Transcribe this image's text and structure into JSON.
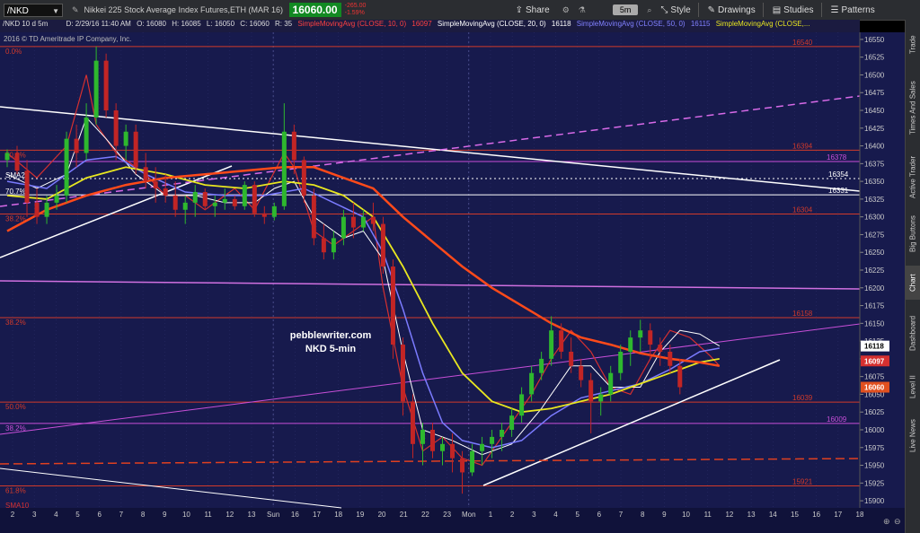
{
  "toolbar": {
    "symbol": "/NKD",
    "description": "Nikkei 225 Stock Average Index Futures,ETH (MAR 16)",
    "last": "16060.00",
    "change": "-265.00",
    "change_pct": "-1.59%",
    "share_label": "Share",
    "timeframe": "5m",
    "style_label": "Style",
    "drawings_label": "Drawings",
    "studies_label": "Studies",
    "patterns_label": "Patterns"
  },
  "infobar": {
    "chart_label": "/NKD 10 d 5m",
    "date": "D: 2/29/16 11:40 AM",
    "open": "O: 16080",
    "high": "H: 16085",
    "low": "L: 16050",
    "close": "C: 16060",
    "range": "R: 35",
    "sma10": "SimpleMovingAvg (CLOSE, 10, 0)",
    "sma10_val": "16097",
    "sma20": "SimpleMovingAvg (CLOSE, 20, 0)",
    "sma20_val": "16118",
    "sma50": "SimpleMovingAvg (CLOSE, 50, 0)",
    "sma50_val": "16115",
    "sma100": "SimpleMovingAvg (CLOSE,..."
  },
  "colors": {
    "background": "#171a4d",
    "candle_up": "#2eb82e",
    "candle_down": "#c22525",
    "sma10": "#d63030",
    "sma20": "#ffffff",
    "sma50": "#7b7bff",
    "sma100": "#e8e620",
    "sma200": "#ff4a1a",
    "fib_red": "#d13a2a",
    "fib_purple": "#c84fd8"
  },
  "sidebar_tabs": [
    "Trade",
    "Times And Sales",
    "Active Trader",
    "Big Buttons",
    "Chart",
    "Dashboard",
    "Level II",
    "Live News"
  ],
  "sidebar_active": "Chart",
  "chart_data": {
    "type": "candlestick",
    "copyright": "2016 © TD Ameritrade IP Company, Inc.",
    "annotation": [
      "pebblewriter.com",
      "NKD 5-min"
    ],
    "ylim": [
      15890,
      16560
    ],
    "y_ticks": [
      15900,
      15925,
      15950,
      15975,
      16000,
      16025,
      16050,
      16075,
      16100,
      16125,
      16150,
      16175,
      16200,
      16225,
      16250,
      16275,
      16300,
      16325,
      16350,
      16375,
      16400,
      16425,
      16450,
      16475,
      16500,
      16525,
      16550
    ],
    "x_ticks": [
      "2",
      "3",
      "4",
      "5",
      "6",
      "7",
      "8",
      "9",
      "10",
      "11",
      "12",
      "13",
      "Sun",
      "16",
      "17",
      "18",
      "19",
      "20",
      "21",
      "22",
      "23",
      "Mon",
      "1",
      "2",
      "3",
      "4",
      "5",
      "6",
      "7",
      "8",
      "9",
      "10",
      "11",
      "12",
      "13",
      "14",
      "15",
      "16",
      "17",
      "18"
    ],
    "x_grid_labels": [
      "Sun",
      "Mon"
    ],
    "fib_levels": [
      {
        "label": "0.0%",
        "value": 16540,
        "price_label": "16540",
        "color": "red"
      },
      {
        "label": "50.0%",
        "value": 16394,
        "price_label": "16394",
        "color": "red"
      },
      {
        "label": "",
        "value": 16378,
        "price_label": "16378",
        "color": "purple"
      },
      {
        "label": "38.2%",
        "value": 16304,
        "price_label": "16304",
        "color": "red"
      },
      {
        "label": "38.2%",
        "value": 16158,
        "price_label": "16158",
        "color": "red"
      },
      {
        "label": "50.0%",
        "value": 16039,
        "price_label": "16039",
        "color": "red"
      },
      {
        "label": "38.2%",
        "value": 16009,
        "price_label": "16009",
        "color": "purple"
      },
      {
        "label": "61.8%",
        "value": 15921,
        "price_label": "15921",
        "color": "red"
      }
    ],
    "white_levels": [
      {
        "label": "SMA20",
        "value": 16354,
        "price_label": "16354"
      },
      {
        "label": "70.7%",
        "value": 16331,
        "price_label": "16331"
      }
    ],
    "sma_text_labels": [
      "SMA10"
    ],
    "last_price_tags": [
      {
        "value": 16118,
        "label": "16118",
        "bg": "#ffffff",
        "fg": "#000000"
      },
      {
        "value": 16097,
        "label": "16097",
        "bg": "#d63030",
        "fg": "#ffffff"
      },
      {
        "value": 16060,
        "label": "16060",
        "bg": "#e05020",
        "fg": "#ffffff"
      }
    ],
    "series": [
      {
        "name": "SMA10",
        "values": [
          [
            0,
            16390
          ],
          [
            3,
            16355
          ],
          [
            6,
            16400
          ],
          [
            8,
            16500
          ],
          [
            9,
            16430
          ],
          [
            11,
            16390
          ],
          [
            14,
            16360
          ],
          [
            16,
            16330
          ],
          [
            18,
            16330
          ],
          [
            20,
            16310
          ],
          [
            23,
            16340
          ],
          [
            25,
            16310
          ],
          [
            28,
            16390
          ],
          [
            29,
            16370
          ],
          [
            31,
            16280
          ],
          [
            33,
            16260
          ],
          [
            35,
            16280
          ],
          [
            37,
            16300
          ],
          [
            38,
            16200
          ],
          [
            40,
            16060
          ],
          [
            42,
            15970
          ],
          [
            44,
            15990
          ],
          [
            46,
            15960
          ],
          [
            48,
            15950
          ],
          [
            50,
            15990
          ],
          [
            53,
            16050
          ],
          [
            55,
            16100
          ],
          [
            57,
            16140
          ],
          [
            59,
            16110
          ],
          [
            61,
            16060
          ],
          [
            63,
            16050
          ],
          [
            65,
            16100
          ],
          [
            67,
            16140
          ],
          [
            69,
            16130
          ],
          [
            71,
            16105
          ],
          [
            72,
            16090
          ]
        ]
      },
      {
        "name": "SMA20",
        "values": [
          [
            0,
            16360
          ],
          [
            3,
            16340
          ],
          [
            6,
            16360
          ],
          [
            8,
            16440
          ],
          [
            10,
            16410
          ],
          [
            13,
            16360
          ],
          [
            16,
            16330
          ],
          [
            19,
            16330
          ],
          [
            22,
            16320
          ],
          [
            25,
            16320
          ],
          [
            27,
            16340
          ],
          [
            29,
            16350
          ],
          [
            31,
            16300
          ],
          [
            34,
            16270
          ],
          [
            36,
            16280
          ],
          [
            38,
            16240
          ],
          [
            40,
            16110
          ],
          [
            42,
            16000
          ],
          [
            45,
            15985
          ],
          [
            48,
            15965
          ],
          [
            51,
            15980
          ],
          [
            54,
            16030
          ],
          [
            57,
            16090
          ],
          [
            59,
            16090
          ],
          [
            61,
            16060
          ],
          [
            64,
            16060
          ],
          [
            66,
            16110
          ],
          [
            68,
            16140
          ],
          [
            70,
            16135
          ],
          [
            72,
            16118
          ]
        ]
      },
      {
        "name": "SMA50",
        "values": [
          [
            0,
            16350
          ],
          [
            4,
            16340
          ],
          [
            8,
            16380
          ],
          [
            11,
            16385
          ],
          [
            14,
            16360
          ],
          [
            18,
            16335
          ],
          [
            22,
            16330
          ],
          [
            26,
            16330
          ],
          [
            30,
            16340
          ],
          [
            33,
            16320
          ],
          [
            36,
            16300
          ],
          [
            38,
            16250
          ],
          [
            40,
            16170
          ],
          [
            42,
            16080
          ],
          [
            44,
            16010
          ],
          [
            46,
            15985
          ],
          [
            49,
            15975
          ],
          [
            52,
            15985
          ],
          [
            55,
            16020
          ],
          [
            58,
            16045
          ],
          [
            61,
            16055
          ],
          [
            64,
            16065
          ],
          [
            67,
            16085
          ],
          [
            70,
            16110
          ],
          [
            72,
            16115
          ]
        ]
      },
      {
        "name": "SMA100",
        "values": [
          [
            0,
            16330
          ],
          [
            4,
            16325
          ],
          [
            8,
            16355
          ],
          [
            12,
            16370
          ],
          [
            16,
            16360
          ],
          [
            20,
            16345
          ],
          [
            24,
            16340
          ],
          [
            28,
            16350
          ],
          [
            31,
            16345
          ],
          [
            34,
            16330
          ],
          [
            37,
            16300
          ],
          [
            40,
            16230
          ],
          [
            43,
            16150
          ],
          [
            46,
            16080
          ],
          [
            49,
            16040
          ],
          [
            52,
            16025
          ],
          [
            55,
            16030
          ],
          [
            58,
            16040
          ],
          [
            61,
            16050
          ],
          [
            64,
            16065
          ],
          [
            67,
            16080
          ],
          [
            70,
            16095
          ],
          [
            72,
            16100
          ]
        ]
      },
      {
        "name": "SMA200",
        "values": [
          [
            0,
            16280
          ],
          [
            4,
            16310
          ],
          [
            8,
            16330
          ],
          [
            12,
            16345
          ],
          [
            16,
            16355
          ],
          [
            20,
            16360
          ],
          [
            24,
            16365
          ],
          [
            28,
            16370
          ],
          [
            31,
            16370
          ],
          [
            34,
            16355
          ],
          [
            37,
            16340
          ],
          [
            40,
            16300
          ],
          [
            43,
            16265
          ],
          [
            46,
            16230
          ],
          [
            49,
            16200
          ],
          [
            52,
            16175
          ],
          [
            55,
            16150
          ],
          [
            58,
            16130
          ],
          [
            61,
            16120
          ],
          [
            64,
            16108
          ],
          [
            67,
            16100
          ],
          [
            70,
            16095
          ],
          [
            72,
            16090
          ]
        ]
      }
    ],
    "candles": [
      [
        0,
        16380,
        16395,
        16370,
        16390
      ],
      [
        1,
        16390,
        16400,
        16360,
        16365
      ],
      [
        2,
        16365,
        16380,
        16300,
        16320
      ],
      [
        3,
        16320,
        16340,
        16290,
        16300
      ],
      [
        4,
        16300,
        16330,
        16290,
        16320
      ],
      [
        5,
        16320,
        16345,
        16310,
        16330
      ],
      [
        6,
        16330,
        16420,
        16320,
        16410
      ],
      [
        7,
        16410,
        16430,
        16370,
        16390
      ],
      [
        8,
        16390,
        16460,
        16380,
        16440
      ],
      [
        9,
        16440,
        16540,
        16430,
        16520
      ],
      [
        10,
        16520,
        16530,
        16440,
        16450
      ],
      [
        11,
        16450,
        16460,
        16380,
        16400
      ],
      [
        12,
        16400,
        16430,
        16380,
        16420
      ],
      [
        13,
        16420,
        16430,
        16360,
        16370
      ],
      [
        14,
        16370,
        16390,
        16340,
        16350
      ],
      [
        15,
        16350,
        16370,
        16320,
        16340
      ],
      [
        16,
        16340,
        16360,
        16320,
        16330
      ],
      [
        17,
        16330,
        16350,
        16300,
        16310
      ],
      [
        18,
        16310,
        16330,
        16290,
        16320
      ],
      [
        19,
        16320,
        16345,
        16300,
        16335
      ],
      [
        20,
        16335,
        16340,
        16310,
        16315
      ],
      [
        21,
        16315,
        16330,
        16300,
        16320
      ],
      [
        22,
        16320,
        16340,
        16310,
        16325
      ],
      [
        23,
        16325,
        16330,
        16310,
        16315
      ],
      [
        24,
        16315,
        16350,
        16310,
        16345
      ],
      [
        25,
        16345,
        16350,
        16300,
        16305
      ],
      [
        26,
        16305,
        16315,
        16290,
        16300
      ],
      [
        27,
        16300,
        16320,
        16295,
        16315
      ],
      [
        28,
        16315,
        16460,
        16310,
        16420
      ],
      [
        29,
        16420,
        16430,
        16360,
        16380
      ],
      [
        30,
        16380,
        16385,
        16320,
        16330
      ],
      [
        31,
        16330,
        16340,
        16260,
        16270
      ],
      [
        32,
        16270,
        16290,
        16240,
        16250
      ],
      [
        33,
        16250,
        16280,
        16240,
        16270
      ],
      [
        34,
        16270,
        16310,
        16260,
        16300
      ],
      [
        35,
        16300,
        16320,
        16270,
        16285
      ],
      [
        36,
        16285,
        16310,
        16280,
        16300
      ],
      [
        37,
        16300,
        16320,
        16280,
        16290
      ],
      [
        38,
        16290,
        16300,
        16220,
        16230
      ],
      [
        39,
        16230,
        16240,
        16100,
        16120
      ],
      [
        40,
        16120,
        16130,
        16020,
        16040
      ],
      [
        41,
        16040,
        16050,
        15960,
        15980
      ],
      [
        42,
        15980,
        16010,
        15950,
        16000
      ],
      [
        43,
        16000,
        16010,
        15960,
        15970
      ],
      [
        44,
        15970,
        15990,
        15950,
        15980
      ],
      [
        45,
        15980,
        15995,
        15940,
        15960
      ],
      [
        46,
        15960,
        15970,
        15910,
        15940
      ],
      [
        47,
        15940,
        15980,
        15935,
        15970
      ],
      [
        48,
        15970,
        15990,
        15950,
        15980
      ],
      [
        49,
        15980,
        16000,
        15960,
        15990
      ],
      [
        50,
        15990,
        16010,
        15970,
        16000
      ],
      [
        51,
        16000,
        16030,
        15990,
        16020
      ],
      [
        52,
        16020,
        16060,
        16010,
        16050
      ],
      [
        53,
        16050,
        16090,
        16040,
        16080
      ],
      [
        54,
        16080,
        16110,
        16070,
        16100
      ],
      [
        55,
        16100,
        16160,
        16090,
        16140
      ],
      [
        56,
        16140,
        16150,
        16100,
        16110
      ],
      [
        57,
        16110,
        16130,
        16080,
        16090
      ],
      [
        58,
        16090,
        16100,
        16060,
        16070
      ],
      [
        59,
        16070,
        16080,
        15995,
        16040
      ],
      [
        60,
        16040,
        16060,
        16020,
        16050
      ],
      [
        61,
        16050,
        16090,
        16040,
        16080
      ],
      [
        62,
        16080,
        16120,
        16070,
        16110
      ],
      [
        63,
        16110,
        16140,
        16090,
        16130
      ],
      [
        64,
        16130,
        16155,
        16110,
        16140
      ],
      [
        65,
        16140,
        16150,
        16100,
        16120
      ],
      [
        66,
        16120,
        16130,
        16090,
        16110
      ],
      [
        67,
        16110,
        16120,
        16080,
        16090
      ],
      [
        68,
        16090,
        16100,
        16050,
        16060
      ]
    ]
  }
}
